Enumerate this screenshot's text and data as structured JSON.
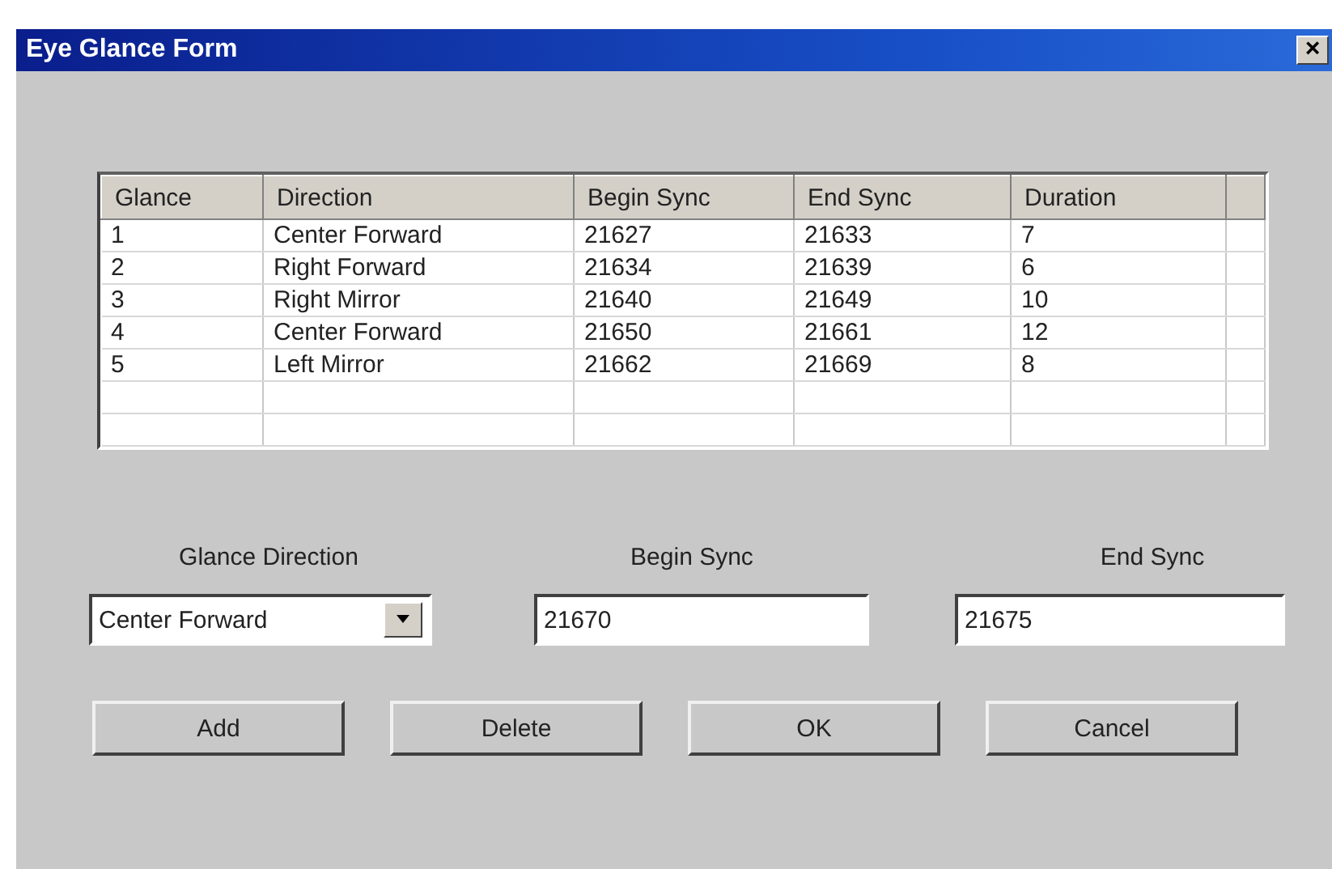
{
  "window": {
    "title": "Eye Glance Form",
    "close": "×"
  },
  "table": {
    "columns": [
      "Glance",
      "Direction",
      "Begin Sync",
      "End Sync",
      "Duration"
    ],
    "rows": [
      [
        "1",
        "Center Forward",
        "21627",
        "21633",
        "7"
      ],
      [
        "2",
        "Right Forward",
        "21634",
        "21639",
        "6"
      ],
      [
        "3",
        "Right Mirror",
        "21640",
        "21649",
        "10"
      ],
      [
        "4",
        "Center Forward",
        "21650",
        "21661",
        "12"
      ],
      [
        "5",
        "Left Mirror",
        "21662",
        "21669",
        "8"
      ]
    ]
  },
  "fields": [
    {
      "kind": "dropdown",
      "label": "Glance Direction",
      "value": "Center Forward"
    },
    {
      "kind": "text",
      "label": "Begin Sync",
      "value": "21670"
    },
    {
      "kind": "text",
      "label": "End Sync",
      "value": "21675"
    }
  ],
  "buttons": [
    "Add",
    "Delete",
    "OK",
    "Cancel"
  ]
}
